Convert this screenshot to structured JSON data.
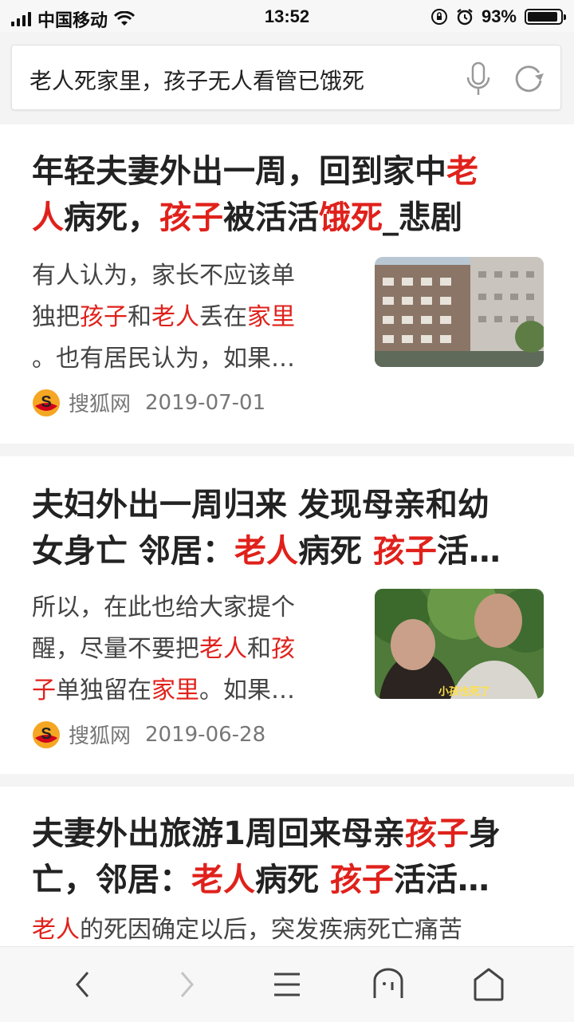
{
  "status_bar": {
    "carrier": "中国移动",
    "time": "13:52",
    "battery": "93%",
    "battery_level": 0.93
  },
  "search": {
    "query": "老人死家里，孩子无人看管已饿死"
  },
  "results": [
    {
      "title_lines": [
        [
          {
            "t": "年轻夫妻外出一周，回到家中"
          },
          {
            "t": "老",
            "hl": true
          }
        ],
        [
          {
            "t": "人",
            "hl": true
          },
          {
            "t": "病死，"
          },
          {
            "t": "孩子",
            "hl": true
          },
          {
            "t": "被活活"
          },
          {
            "t": "饿死",
            "hl": true
          },
          {
            "t": "_悲剧"
          }
        ]
      ],
      "desc_lines": [
        [
          {
            "t": "有人认为，家长不应该单"
          }
        ],
        [
          {
            "t": "独把"
          },
          {
            "t": "孩子",
            "hl": true
          },
          {
            "t": "和"
          },
          {
            "t": "老人",
            "hl": true
          },
          {
            "t": "丢在"
          },
          {
            "t": "家里",
            "hl": true
          }
        ],
        [
          {
            "t": "。也有居民认为，如果…"
          }
        ]
      ],
      "source": "搜狐网",
      "date": "2019-07-01"
    },
    {
      "title_lines": [
        [
          {
            "t": "夫妇外出一周归来 发现母亲和幼"
          }
        ],
        [
          {
            "t": "女身亡 邻居："
          },
          {
            "t": "老人",
            "hl": true
          },
          {
            "t": "病死 "
          },
          {
            "t": "孩子",
            "hl": true
          },
          {
            "t": "活…"
          }
        ]
      ],
      "desc_lines": [
        [
          {
            "t": "所以，在此也给大家提个"
          }
        ],
        [
          {
            "t": "醒，尽量不要把"
          },
          {
            "t": "老人",
            "hl": true
          },
          {
            "t": "和"
          },
          {
            "t": "孩",
            "hl": true
          }
        ],
        [
          {
            "t": "子",
            "hl": true
          },
          {
            "t": "单独留在"
          },
          {
            "t": "家里",
            "hl": true
          },
          {
            "t": "。如果…"
          }
        ]
      ],
      "source": "搜狐网",
      "date": "2019-06-28",
      "thumb_caption": "小孩也死了"
    },
    {
      "title_lines": [
        [
          {
            "t": "夫妻外出旅游1周回来母亲"
          },
          {
            "t": "孩子",
            "hl": true
          },
          {
            "t": "身"
          }
        ],
        [
          {
            "t": "亡，邻居："
          },
          {
            "t": "老人",
            "hl": true
          },
          {
            "t": "病死 "
          },
          {
            "t": "孩子",
            "hl": true
          },
          {
            "t": "活活…"
          }
        ]
      ],
      "desc_lines": [
        [
          {
            "t": "老人",
            "hl": true
          },
          {
            "t": "的死因确定以后，突发疾病死亡痛苦"
          }
        ]
      ]
    }
  ],
  "colors": {
    "highlight": "#e0211b",
    "sohu_logo": "#f5a623"
  },
  "toolbar": {
    "icons": [
      "back-icon",
      "forward-icon",
      "menu-icon",
      "home-page-icon",
      "tabs-icon"
    ]
  }
}
